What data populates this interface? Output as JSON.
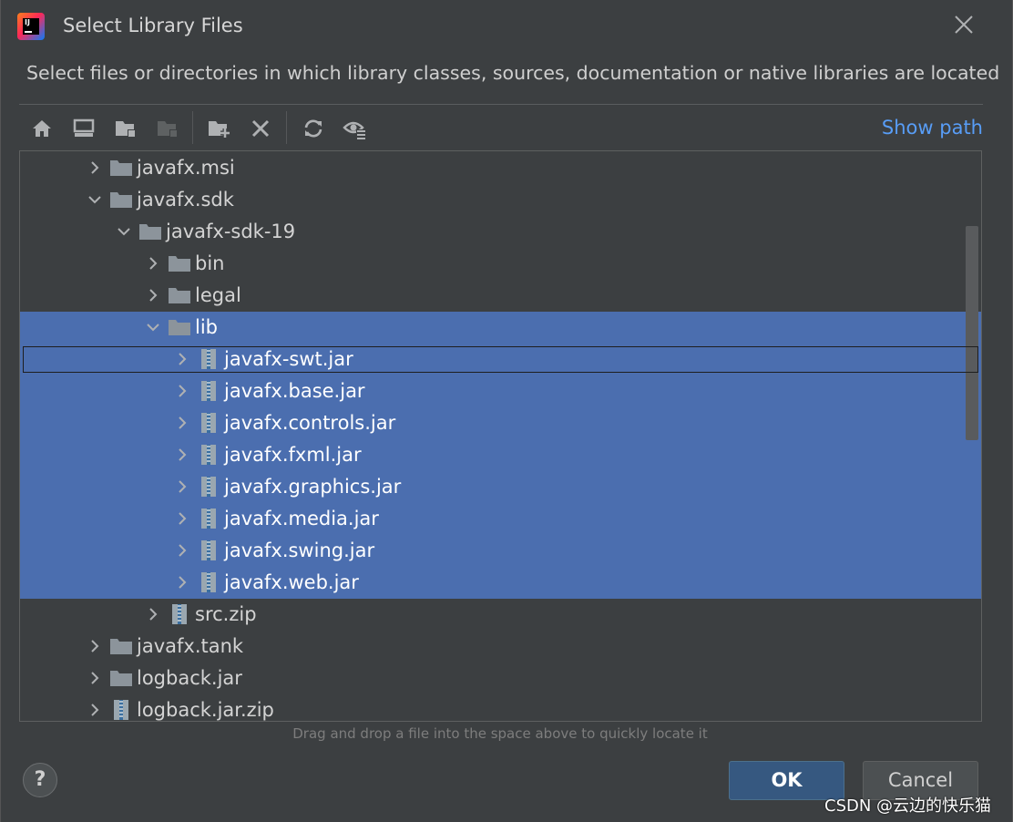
{
  "window": {
    "title": "Select Library Files",
    "description": "Select files or directories in which library classes, sources, documentation or native libraries are located"
  },
  "toolbar": {
    "buttons": [
      {
        "icon": "home-icon"
      },
      {
        "icon": "desktop-icon"
      },
      {
        "icon": "project-folder-icon"
      },
      {
        "icon": "module-folder-icon"
      },
      {
        "icon": "new-folder-icon"
      },
      {
        "icon": "delete-icon"
      },
      {
        "icon": "refresh-icon"
      },
      {
        "icon": "show-hidden-icon"
      }
    ],
    "show_path_label": "Show path"
  },
  "tree": {
    "rows": [
      {
        "label": "javafx.msi",
        "depth": 0,
        "expanded": false,
        "type": "folder",
        "selected": false
      },
      {
        "label": "javafx.sdk",
        "depth": 0,
        "expanded": true,
        "type": "folder",
        "selected": false
      },
      {
        "label": "javafx-sdk-19",
        "depth": 1,
        "expanded": true,
        "type": "folder",
        "selected": false
      },
      {
        "label": "bin",
        "depth": 2,
        "expanded": false,
        "type": "folder",
        "selected": false
      },
      {
        "label": "legal",
        "depth": 2,
        "expanded": false,
        "type": "folder",
        "selected": false
      },
      {
        "label": "lib",
        "depth": 2,
        "expanded": true,
        "type": "folder",
        "selected": true
      },
      {
        "label": "javafx-swt.jar",
        "depth": 3,
        "expanded": false,
        "type": "archive",
        "selected": true
      },
      {
        "label": "javafx.base.jar",
        "depth": 3,
        "expanded": false,
        "type": "archive",
        "selected": true
      },
      {
        "label": "javafx.controls.jar",
        "depth": 3,
        "expanded": false,
        "type": "archive",
        "selected": true
      },
      {
        "label": "javafx.fxml.jar",
        "depth": 3,
        "expanded": false,
        "type": "archive",
        "selected": true
      },
      {
        "label": "javafx.graphics.jar",
        "depth": 3,
        "expanded": false,
        "type": "archive",
        "selected": true
      },
      {
        "label": "javafx.media.jar",
        "depth": 3,
        "expanded": false,
        "type": "archive",
        "selected": true
      },
      {
        "label": "javafx.swing.jar",
        "depth": 3,
        "expanded": false,
        "type": "archive",
        "selected": true
      },
      {
        "label": "javafx.web.jar",
        "depth": 3,
        "expanded": false,
        "type": "archive",
        "selected": true
      },
      {
        "label": "src.zip",
        "depth": 2,
        "expanded": false,
        "type": "archive",
        "selected": false
      },
      {
        "label": "javafx.tank",
        "depth": 0,
        "expanded": false,
        "type": "folder",
        "selected": false
      },
      {
        "label": "logback.jar",
        "depth": 0,
        "expanded": false,
        "type": "folder",
        "selected": false
      },
      {
        "label": "logback.jar.zip",
        "depth": 0,
        "expanded": false,
        "type": "archive",
        "selected": false
      }
    ]
  },
  "hint": "Drag and drop a file into the space above to quickly locate it",
  "buttons": {
    "help": "?",
    "ok": "OK",
    "cancel": "Cancel"
  },
  "watermark": "CSDN @云边的快乐猫",
  "colors": {
    "background": "#3c3f41",
    "selection": "#4b6eaf",
    "link": "#589df6",
    "ok_button": "#365880"
  }
}
